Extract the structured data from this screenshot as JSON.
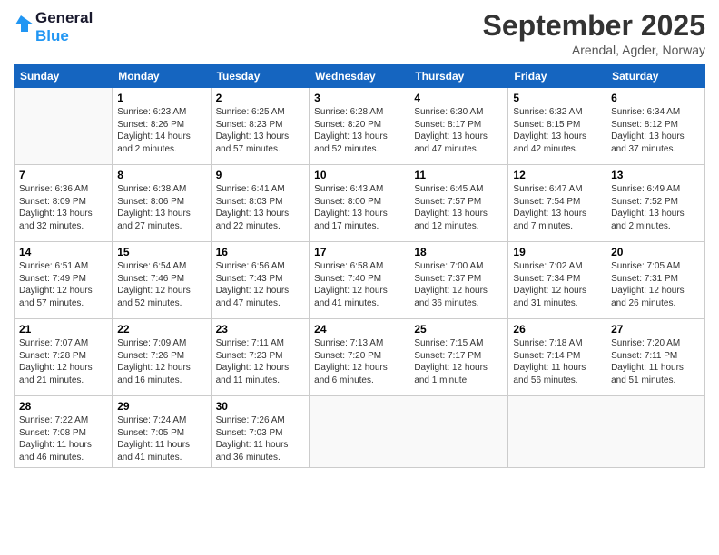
{
  "logo": {
    "line1": "General",
    "line2": "Blue"
  },
  "title": "September 2025",
  "location": "Arendal, Agder, Norway",
  "weekdays": [
    "Sunday",
    "Monday",
    "Tuesday",
    "Wednesday",
    "Thursday",
    "Friday",
    "Saturday"
  ],
  "weeks": [
    [
      {
        "day": null
      },
      {
        "day": 1,
        "sunrise": "6:23 AM",
        "sunset": "8:26 PM",
        "daylight": "14 hours and 2 minutes."
      },
      {
        "day": 2,
        "sunrise": "6:25 AM",
        "sunset": "8:23 PM",
        "daylight": "13 hours and 57 minutes."
      },
      {
        "day": 3,
        "sunrise": "6:28 AM",
        "sunset": "8:20 PM",
        "daylight": "13 hours and 52 minutes."
      },
      {
        "day": 4,
        "sunrise": "6:30 AM",
        "sunset": "8:17 PM",
        "daylight": "13 hours and 47 minutes."
      },
      {
        "day": 5,
        "sunrise": "6:32 AM",
        "sunset": "8:15 PM",
        "daylight": "13 hours and 42 minutes."
      },
      {
        "day": 6,
        "sunrise": "6:34 AM",
        "sunset": "8:12 PM",
        "daylight": "13 hours and 37 minutes."
      }
    ],
    [
      {
        "day": 7,
        "sunrise": "6:36 AM",
        "sunset": "8:09 PM",
        "daylight": "13 hours and 32 minutes."
      },
      {
        "day": 8,
        "sunrise": "6:38 AM",
        "sunset": "8:06 PM",
        "daylight": "13 hours and 27 minutes."
      },
      {
        "day": 9,
        "sunrise": "6:41 AM",
        "sunset": "8:03 PM",
        "daylight": "13 hours and 22 minutes."
      },
      {
        "day": 10,
        "sunrise": "6:43 AM",
        "sunset": "8:00 PM",
        "daylight": "13 hours and 17 minutes."
      },
      {
        "day": 11,
        "sunrise": "6:45 AM",
        "sunset": "7:57 PM",
        "daylight": "13 hours and 12 minutes."
      },
      {
        "day": 12,
        "sunrise": "6:47 AM",
        "sunset": "7:54 PM",
        "daylight": "13 hours and 7 minutes."
      },
      {
        "day": 13,
        "sunrise": "6:49 AM",
        "sunset": "7:52 PM",
        "daylight": "13 hours and 2 minutes."
      }
    ],
    [
      {
        "day": 14,
        "sunrise": "6:51 AM",
        "sunset": "7:49 PM",
        "daylight": "12 hours and 57 minutes."
      },
      {
        "day": 15,
        "sunrise": "6:54 AM",
        "sunset": "7:46 PM",
        "daylight": "12 hours and 52 minutes."
      },
      {
        "day": 16,
        "sunrise": "6:56 AM",
        "sunset": "7:43 PM",
        "daylight": "12 hours and 47 minutes."
      },
      {
        "day": 17,
        "sunrise": "6:58 AM",
        "sunset": "7:40 PM",
        "daylight": "12 hours and 41 minutes."
      },
      {
        "day": 18,
        "sunrise": "7:00 AM",
        "sunset": "7:37 PM",
        "daylight": "12 hours and 36 minutes."
      },
      {
        "day": 19,
        "sunrise": "7:02 AM",
        "sunset": "7:34 PM",
        "daylight": "12 hours and 31 minutes."
      },
      {
        "day": 20,
        "sunrise": "7:05 AM",
        "sunset": "7:31 PM",
        "daylight": "12 hours and 26 minutes."
      }
    ],
    [
      {
        "day": 21,
        "sunrise": "7:07 AM",
        "sunset": "7:28 PM",
        "daylight": "12 hours and 21 minutes."
      },
      {
        "day": 22,
        "sunrise": "7:09 AM",
        "sunset": "7:26 PM",
        "daylight": "12 hours and 16 minutes."
      },
      {
        "day": 23,
        "sunrise": "7:11 AM",
        "sunset": "7:23 PM",
        "daylight": "12 hours and 11 minutes."
      },
      {
        "day": 24,
        "sunrise": "7:13 AM",
        "sunset": "7:20 PM",
        "daylight": "12 hours and 6 minutes."
      },
      {
        "day": 25,
        "sunrise": "7:15 AM",
        "sunset": "7:17 PM",
        "daylight": "12 hours and 1 minute."
      },
      {
        "day": 26,
        "sunrise": "7:18 AM",
        "sunset": "7:14 PM",
        "daylight": "11 hours and 56 minutes."
      },
      {
        "day": 27,
        "sunrise": "7:20 AM",
        "sunset": "7:11 PM",
        "daylight": "11 hours and 51 minutes."
      }
    ],
    [
      {
        "day": 28,
        "sunrise": "7:22 AM",
        "sunset": "7:08 PM",
        "daylight": "11 hours and 46 minutes."
      },
      {
        "day": 29,
        "sunrise": "7:24 AM",
        "sunset": "7:05 PM",
        "daylight": "11 hours and 41 minutes."
      },
      {
        "day": 30,
        "sunrise": "7:26 AM",
        "sunset": "7:03 PM",
        "daylight": "11 hours and 36 minutes."
      },
      {
        "day": null
      },
      {
        "day": null
      },
      {
        "day": null
      },
      {
        "day": null
      }
    ]
  ],
  "labels": {
    "sunrise": "Sunrise:",
    "sunset": "Sunset:",
    "daylight": "Daylight:"
  }
}
